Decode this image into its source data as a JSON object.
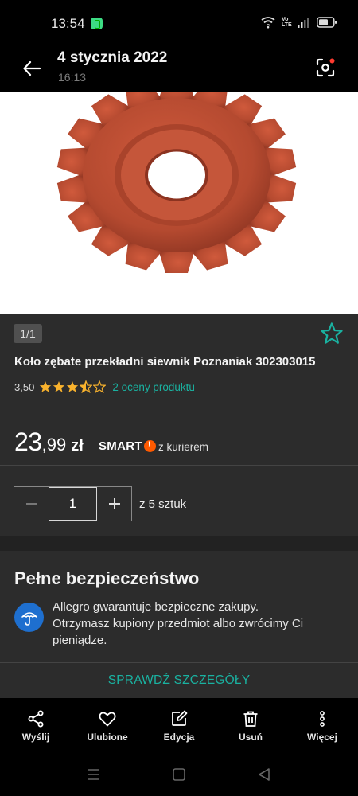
{
  "status_bar": {
    "time": "13:54",
    "volte_label": "Vo LTE"
  },
  "app_bar": {
    "title": "4 stycznia 2022",
    "subtitle": "16:13"
  },
  "gallery": {
    "counter": "1/1",
    "image_color": "#b9482f"
  },
  "product": {
    "title": "Koło zębate przekładni siewnik Poznaniak 302303015",
    "rating_value": "3,50",
    "rating": 3.5,
    "rating_max": 5,
    "ratings_link": "2 oceny produktu",
    "price_main": "23",
    "price_cents": ",99",
    "price_currency": "zł",
    "smart_label": "SMART",
    "delivery": "z kurierem",
    "quantity": "1",
    "stock": "z 5 sztuk"
  },
  "safety": {
    "title": "Pełne bezpieczeństwo",
    "line1": "Allegro gwarantuje bezpieczne zakupy.",
    "line2": "Otrzymasz kupiony przedmiot albo zwrócimy Ci",
    "line3": "pieniądze.",
    "details_link": "SPRAWDŹ SZCZEGÓŁY"
  },
  "bottom_bar": {
    "items": [
      {
        "label": "Wyślij",
        "icon": "share-icon"
      },
      {
        "label": "Ulubione",
        "icon": "heart-icon"
      },
      {
        "label": "Edycja",
        "icon": "edit-icon"
      },
      {
        "label": "Usuń",
        "icon": "trash-icon"
      },
      {
        "label": "Więcej",
        "icon": "more-vertical-icon"
      }
    ]
  },
  "colors": {
    "accent": "#1ab1a0",
    "star": "#f8b22d",
    "smart_orange": "#ff5a00",
    "surface": "#2c2c2c",
    "shield_blue": "#1e6fcf"
  }
}
